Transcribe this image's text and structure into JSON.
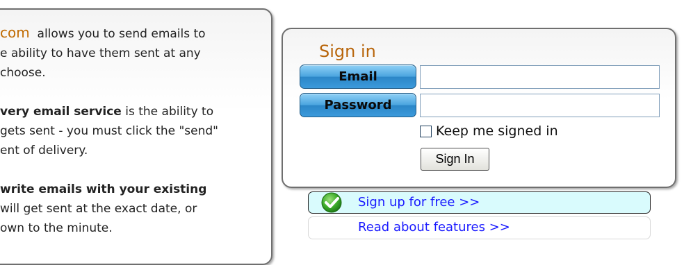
{
  "info": {
    "p1_brand": "com",
    "p1_line1": "allows you to send emails to",
    "p1_line2": "e ability to have them sent at any",
    "p1_line3": "choose.",
    "p2_bold": "very email service",
    "p2_line1_rest": "is the ability to",
    "p2_line2": "gets sent - you must click the \"send\"",
    "p2_line3": "ent of delivery.",
    "p3_bold": "write emails with your existing",
    "p3_line2": "will get sent at the exact date, or",
    "p3_line3": "own to the minute."
  },
  "signin": {
    "title": "Sign in",
    "email_label": "Email",
    "password_label": "Password",
    "email_value": "",
    "password_value": "",
    "keep_signed_in": "Keep me signed in",
    "button": "Sign In"
  },
  "links": {
    "signup": "Sign up for free >>",
    "features": "Read about features >>"
  },
  "colors": {
    "brand": "#c06a00",
    "title": "#b8650a",
    "link": "#1a1aff",
    "signup_bg": "#d9fbfd",
    "label_blue": "#3b9adb"
  },
  "icons": {
    "signup": "green-check-icon"
  }
}
